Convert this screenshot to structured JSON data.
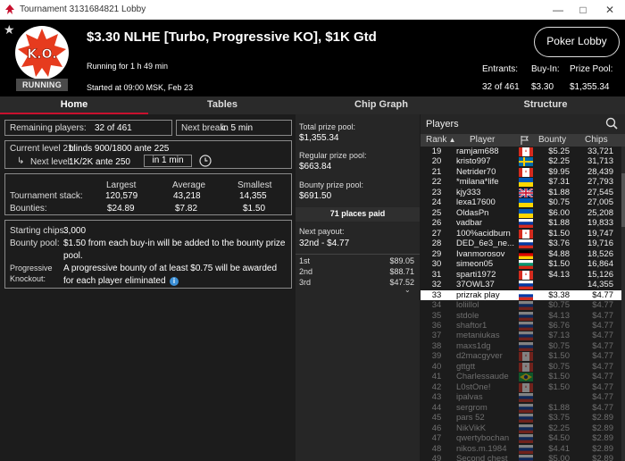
{
  "window": {
    "title": "Tournament 3131684821 Lobby"
  },
  "header": {
    "logo_text": "K.O.",
    "status": "RUNNING",
    "title": "$3.30 NLHE [Turbo, Progressive KO], $1K Gtd",
    "running_for": "Running for 1 h 49 min",
    "started_at": "Started at 09:00 MSK, Feb 23",
    "lobby_button": "Poker Lobby",
    "entrants_label": "Entrants:",
    "entrants_value": "32 of 461",
    "buyin_label": "Buy-In:",
    "buyin_value": "$3.30",
    "prize_label": "Prize Pool:",
    "prize_value": "$1,355.34"
  },
  "tabs": [
    "Home",
    "Tables",
    "Chip Graph",
    "Structure"
  ],
  "home": {
    "remaining_label": "Remaining players:",
    "remaining_value": "32 of 461",
    "next_break_label": "Next break:",
    "next_break_value": "in 5 min",
    "current_level_label": "Current level 21:",
    "current_level_value": "blinds 900/1800 ante 225",
    "next_level_label": "Next level:",
    "next_level_value": "1K/2K ante 250",
    "next_level_timer": "in 1 min",
    "stack_headers": [
      "Largest",
      "Average",
      "Smallest"
    ],
    "tournament_stack_label": "Tournament stack:",
    "tournament_stack": [
      "120,579",
      "43,218",
      "14,355"
    ],
    "bounties_label": "Bounties:",
    "bounties": [
      "$24.89",
      "$7.82",
      "$1.50"
    ],
    "starting_chips_label": "Starting chips:",
    "starting_chips_value": "3,000",
    "bounty_pool_label": "Bounty pool:",
    "bounty_pool_line1": "$1.50 from each buy-in will be added to the bounty prize",
    "bounty_pool_line2": "pool.",
    "progressive_label1": "Progressive",
    "progressive_label2": "Knockout:",
    "progressive_line1": "A progressive bounty of at least $0.75 will be awarded",
    "progressive_line2": "for each player eliminated"
  },
  "prize": {
    "total_label": "Total prize pool:",
    "total_value": "$1,355.34",
    "regular_label": "Regular prize pool:",
    "regular_value": "$663.84",
    "bounty_label": "Bounty prize pool:",
    "bounty_value": "$691.50",
    "places_paid": "71 places paid",
    "next_payout_label": "Next payout:",
    "next_payout_value": "32nd - $4.77",
    "payouts": [
      {
        "place": "1st",
        "amount": "$89.05"
      },
      {
        "place": "2nd",
        "amount": "$88.71"
      },
      {
        "place": "3rd",
        "amount": "$47.52"
      }
    ]
  },
  "players": {
    "title": "Players",
    "columns": [
      "Rank",
      "Player",
      "Bounty",
      "Chips"
    ],
    "rows": [
      {
        "rank": "19",
        "name": "ramjam688",
        "flag": "ca",
        "bounty": "$5.25",
        "chips": "33,721",
        "state": "active"
      },
      {
        "rank": "20",
        "name": "kristo997",
        "flag": "se",
        "bounty": "$2.25",
        "chips": "31,713",
        "state": "active"
      },
      {
        "rank": "21",
        "name": "Netrider70",
        "flag": "ca",
        "bounty": "$9.95",
        "chips": "28,439",
        "state": "active"
      },
      {
        "rank": "22",
        "name": "*milana*life",
        "flag": "ua",
        "bounty": "$7.31",
        "chips": "27,793",
        "state": "active"
      },
      {
        "rank": "23",
        "name": "kjy333",
        "flag": "gb",
        "bounty": "$1.88",
        "chips": "27,545",
        "state": "active"
      },
      {
        "rank": "24",
        "name": "lexa17600",
        "flag": "ua",
        "bounty": "$0.75",
        "chips": "27,005",
        "state": "active"
      },
      {
        "rank": "25",
        "name": "OldasPn",
        "flag": "ua",
        "bounty": "$6.00",
        "chips": "25,208",
        "state": "active"
      },
      {
        "rank": "26",
        "name": "vadbar",
        "flag": "ru",
        "bounty": "$1.88",
        "chips": "19,833",
        "state": "active"
      },
      {
        "rank": "27",
        "name": "100%acidburn",
        "flag": "ca",
        "bounty": "$1.50",
        "chips": "19,747",
        "state": "active"
      },
      {
        "rank": "28",
        "name": "DED_6e3_ne...",
        "flag": "ru",
        "bounty": "$3.76",
        "chips": "19,716",
        "state": "active"
      },
      {
        "rank": "29",
        "name": "Ivanmorosov",
        "flag": "de",
        "bounty": "$4.88",
        "chips": "18,526",
        "state": "active"
      },
      {
        "rank": "30",
        "name": "simeon05",
        "flag": "bg",
        "bounty": "$1.50",
        "chips": "16,864",
        "state": "active"
      },
      {
        "rank": "31",
        "name": "sparti1972",
        "flag": "ca",
        "bounty": "$4.13",
        "chips": "15,126",
        "state": "active"
      },
      {
        "rank": "32",
        "name": "37OWL37",
        "flag": "ru",
        "bounty": "",
        "chips": "14,355",
        "state": "active"
      },
      {
        "rank": "33",
        "name": "prizrak play",
        "flag": "ru",
        "bounty": "$3.38",
        "chips": "$4.77",
        "state": "hl"
      },
      {
        "rank": "34",
        "name": "loliillol",
        "flag": "ru",
        "bounty": "$0.75",
        "chips": "$4.77",
        "state": "out"
      },
      {
        "rank": "35",
        "name": "stdole",
        "flag": "ru",
        "bounty": "$4.13",
        "chips": "$4.77",
        "state": "out"
      },
      {
        "rank": "36",
        "name": "shaftor1",
        "flag": "ru",
        "bounty": "$6.76",
        "chips": "$4.77",
        "state": "out"
      },
      {
        "rank": "37",
        "name": "metaniukas",
        "flag": "ru",
        "bounty": "$7.13",
        "chips": "$4.77",
        "state": "out"
      },
      {
        "rank": "38",
        "name": "maxs1dg",
        "flag": "ru",
        "bounty": "$0.75",
        "chips": "$4.77",
        "state": "out"
      },
      {
        "rank": "39",
        "name": "d2macgyver",
        "flag": "ca",
        "bounty": "$1.50",
        "chips": "$4.77",
        "state": "out"
      },
      {
        "rank": "40",
        "name": "gttgtt",
        "flag": "ca",
        "bounty": "$0.75",
        "chips": "$4.77",
        "state": "out"
      },
      {
        "rank": "41",
        "name": "Charlessaude",
        "flag": "br",
        "bounty": "$1.50",
        "chips": "$4.77",
        "state": "out"
      },
      {
        "rank": "42",
        "name": "L0stOne!",
        "flag": "ca",
        "bounty": "$1.50",
        "chips": "$4.77",
        "state": "out"
      },
      {
        "rank": "43",
        "name": "ipalvas",
        "flag": "ru",
        "bounty": "",
        "chips": "$4.77",
        "state": "out"
      },
      {
        "rank": "44",
        "name": "sergrom",
        "flag": "ru",
        "bounty": "$1.88",
        "chips": "$4.77",
        "state": "out"
      },
      {
        "rank": "45",
        "name": "pars 52",
        "flag": "ru",
        "bounty": "$3.75",
        "chips": "$2.89",
        "state": "out"
      },
      {
        "rank": "46",
        "name": "NikVikK",
        "flag": "ru",
        "bounty": "$2.25",
        "chips": "$2.89",
        "state": "out"
      },
      {
        "rank": "47",
        "name": "qwertybochan",
        "flag": "ru",
        "bounty": "$4.50",
        "chips": "$2.89",
        "state": "out"
      },
      {
        "rank": "48",
        "name": "nikos.m.1984",
        "flag": "ru",
        "bounty": "$4.41",
        "chips": "$2.89",
        "state": "out"
      },
      {
        "rank": "49",
        "name": "Second chest",
        "flag": "ru",
        "bounty": "$5.00",
        "chips": "$2.89",
        "state": "out"
      }
    ]
  },
  "colors": {
    "accent": "#c8102e",
    "header_bg": "#000000",
    "panel_bg": "#1c1c1c"
  }
}
